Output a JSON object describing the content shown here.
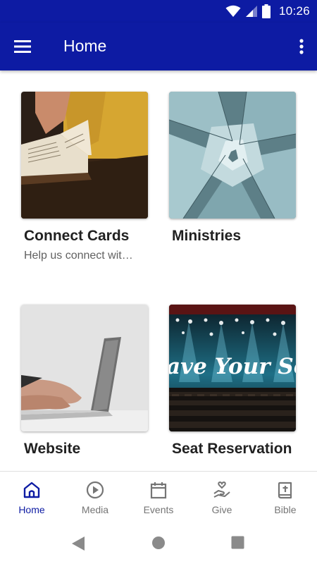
{
  "status_bar": {
    "time": "10:26",
    "icons": [
      "wifi-icon",
      "cell-signal-icon",
      "battery-icon"
    ]
  },
  "app_bar": {
    "title": "Home",
    "menu_icon": "hamburger-menu-icon",
    "overflow_icon": "more-vert-icon"
  },
  "cards": [
    {
      "title": "Connect Cards",
      "subtitle": "Help us connect wit…",
      "image": "open-bible-photo"
    },
    {
      "title": "Ministries",
      "subtitle": "",
      "image": "succulent-plant-photo"
    },
    {
      "title": "Website",
      "subtitle": "",
      "image": "laptop-typing-photo"
    },
    {
      "title": "Seat Reservation",
      "subtitle": "",
      "image": "theater-seats-photo",
      "image_text": "ave Your Seat"
    }
  ],
  "bottom_nav": {
    "items": [
      {
        "label": "Home",
        "icon": "home-icon",
        "active": true
      },
      {
        "label": "Media",
        "icon": "play-circle-icon",
        "active": false
      },
      {
        "label": "Events",
        "icon": "calendar-icon",
        "active": false
      },
      {
        "label": "Give",
        "icon": "give-hand-heart-icon",
        "active": false
      },
      {
        "label": "Bible",
        "icon": "bible-book-icon",
        "active": false
      }
    ]
  },
  "colors": {
    "primary": "#0d1ba3",
    "nav_inactive": "#757575",
    "title_text": "#212121",
    "subtitle_text": "#616161"
  }
}
